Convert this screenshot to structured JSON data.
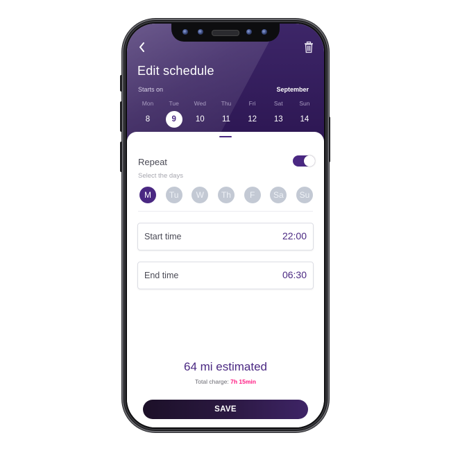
{
  "header": {
    "title": "Edit schedule",
    "starts_on_label": "Starts on",
    "month": "September",
    "back_icon": "chevron-left-icon",
    "delete_icon": "trash-icon",
    "week": [
      {
        "name": "Mon",
        "num": "8",
        "selected": false
      },
      {
        "name": "Tue",
        "num": "9",
        "selected": true
      },
      {
        "name": "Wed",
        "num": "10",
        "selected": false
      },
      {
        "name": "Thu",
        "num": "11",
        "selected": false
      },
      {
        "name": "Fri",
        "num": "12",
        "selected": false
      },
      {
        "name": "Sat",
        "num": "13",
        "selected": false
      },
      {
        "name": "Sun",
        "num": "14",
        "selected": false
      }
    ]
  },
  "repeat": {
    "label": "Repeat",
    "enabled": true,
    "select_days_label": "Select the days",
    "days": [
      {
        "label": "M",
        "selected": true
      },
      {
        "label": "Tu",
        "selected": false
      },
      {
        "label": "W",
        "selected": false
      },
      {
        "label": "Th",
        "selected": false
      },
      {
        "label": "F",
        "selected": false
      },
      {
        "label": "Sa",
        "selected": false
      },
      {
        "label": "Su",
        "selected": false
      }
    ]
  },
  "times": {
    "start": {
      "label": "Start time",
      "value": "22:00"
    },
    "end": {
      "label": "End time",
      "value": "06:30"
    }
  },
  "summary": {
    "estimate": "64 mi estimated",
    "charge_label": "Total charge:",
    "charge_value": "7h 15min"
  },
  "save_label": "SAVE",
  "colors": {
    "primary": "#4a2882",
    "header_bg": "#2c1652",
    "accent": "#ff1a82",
    "day_inactive": "#c3c9d4"
  }
}
